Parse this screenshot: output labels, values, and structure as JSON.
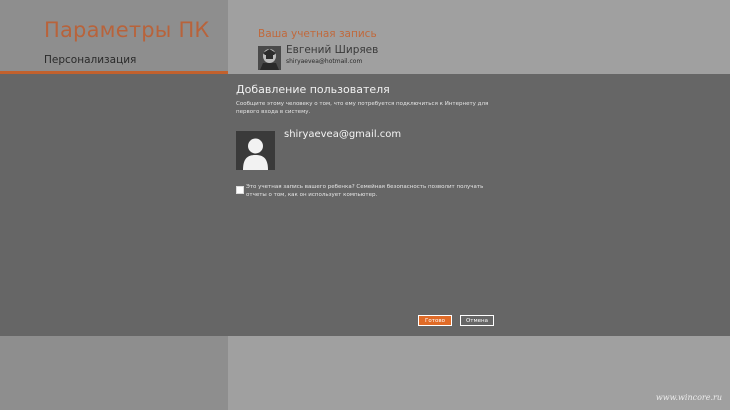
{
  "app": {
    "title": "Параметры ПК"
  },
  "nav": {
    "selected": "Персонализация"
  },
  "account": {
    "header": "Ваша учетная запись",
    "name": "Евгений Ширяев",
    "email": "shiryaevea@hotmail.com"
  },
  "dialog": {
    "title": "Добавление пользователя",
    "description": "Сообщите этому человеку о том, что ему потребуется подключиться к Интернету для первого входа в систему.",
    "user_email": "shiryaevea@gmail.com",
    "child_checkbox_label": "Это учетная запись вашего ребенка? Семейная безопасность позволит получать отчеты о том, как он использует компьютер.",
    "child_checkbox_checked": false,
    "ok_label": "Готово",
    "cancel_label": "Отмена"
  },
  "watermark": "www.wincore.ru",
  "colors": {
    "accent": "#c2612d",
    "button_primary": "#e06b27",
    "dialog_bg": "#666666"
  }
}
